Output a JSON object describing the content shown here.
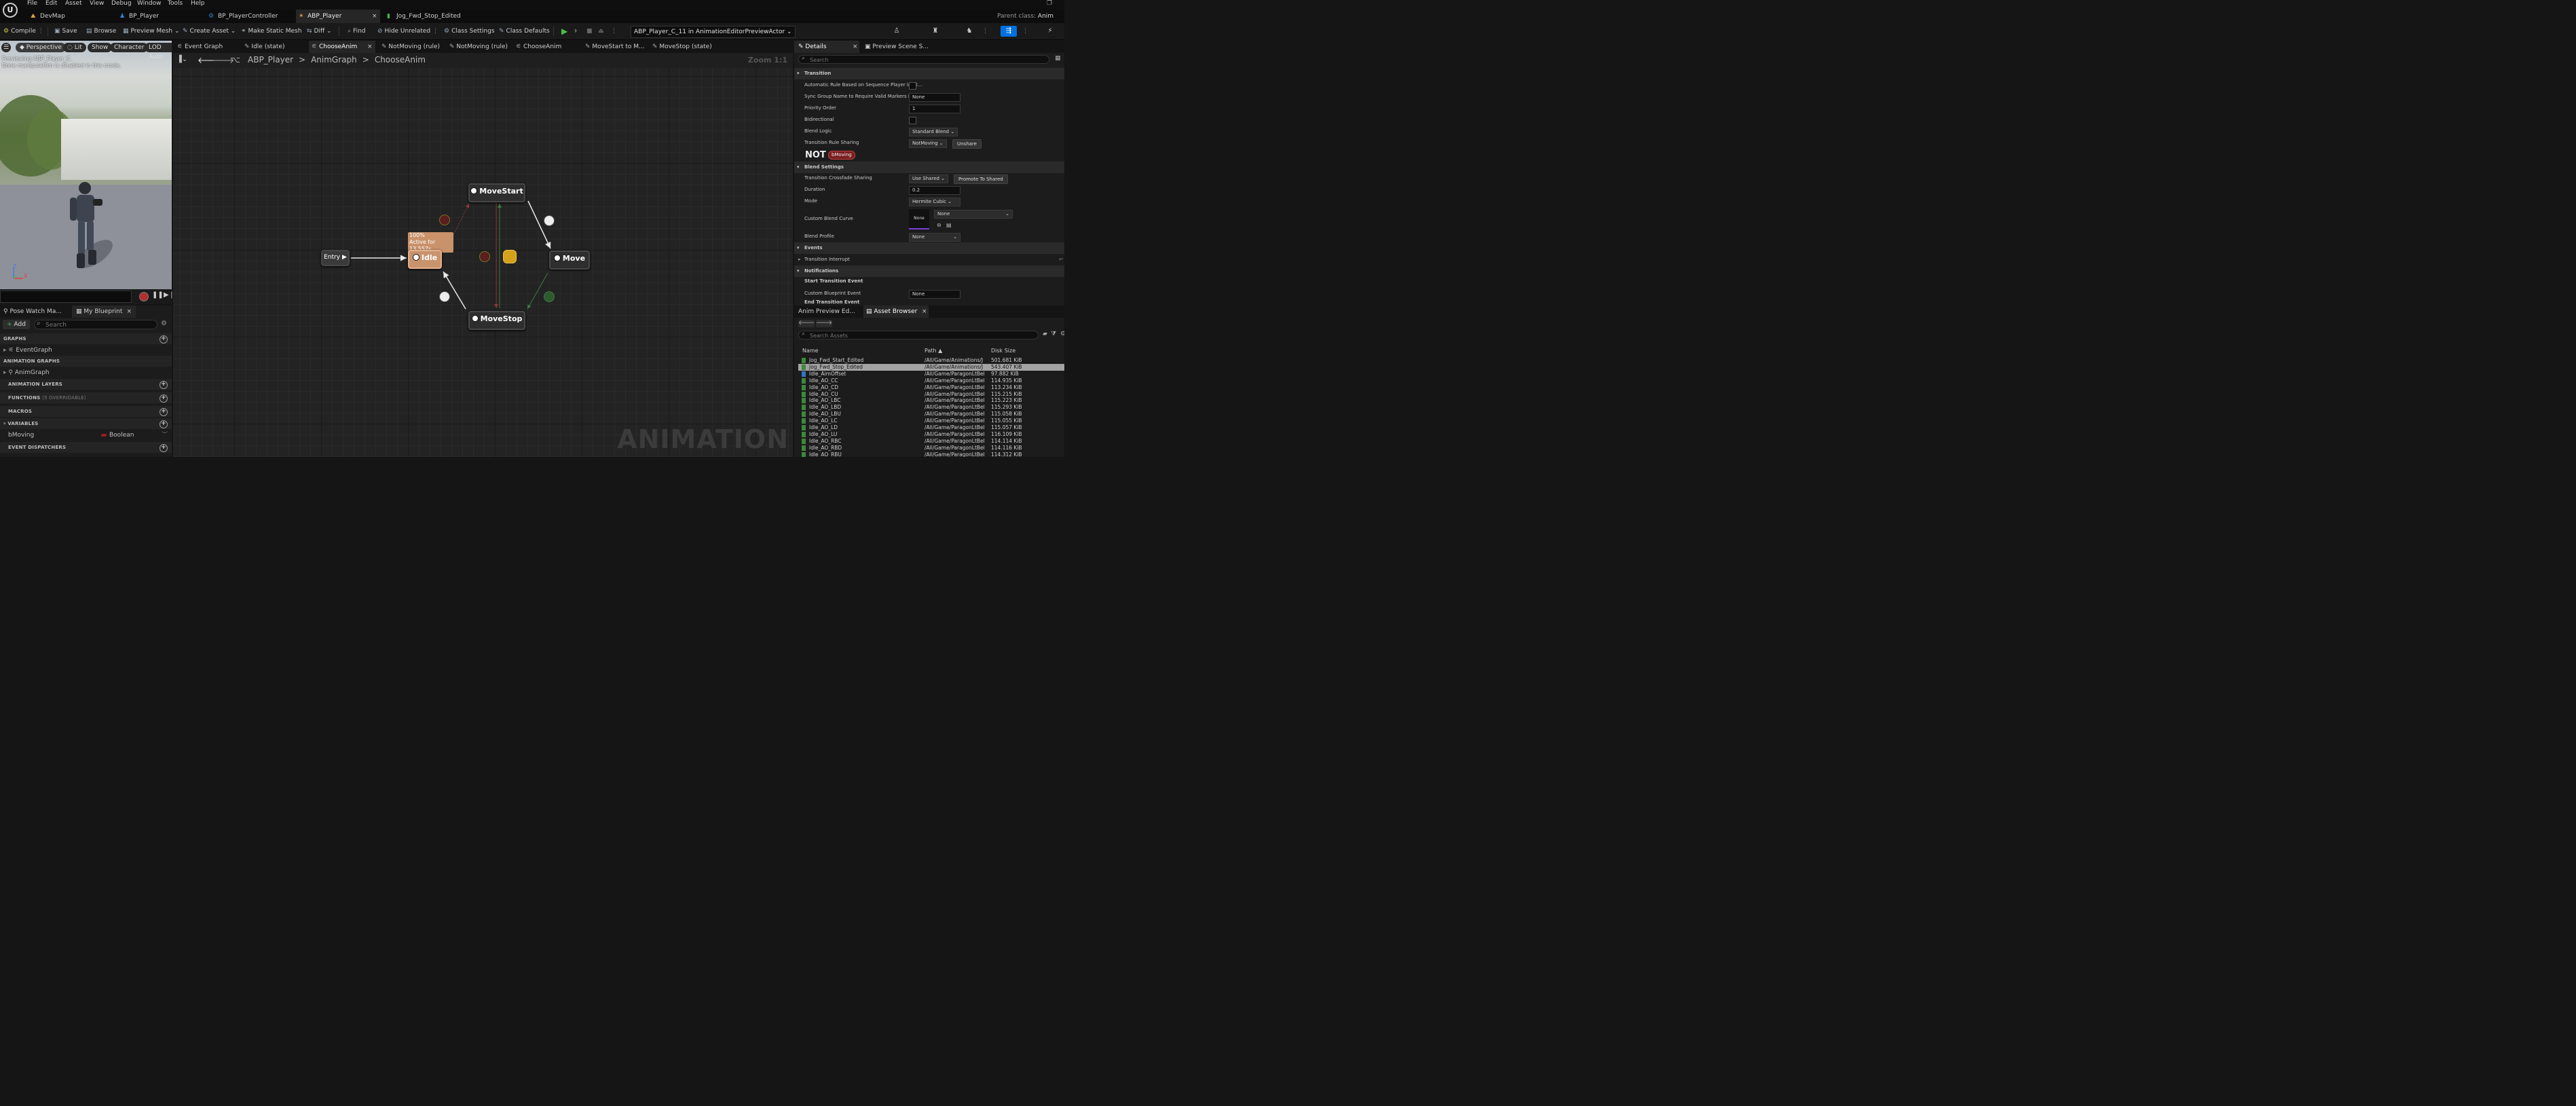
{
  "menu": [
    "File",
    "Edit",
    "Asset",
    "View",
    "Debug",
    "Window",
    "Tools",
    "Help"
  ],
  "tabs": [
    {
      "label": "DevMap"
    },
    {
      "label": "BP_Player"
    },
    {
      "label": "BP_PlayerController"
    },
    {
      "label": "ABP_Player",
      "close": "×"
    },
    {
      "label": "Jog_Fwd_Stop_Edited"
    }
  ],
  "parent_class": {
    "label": "Parent class:",
    "value": "Anim Instanc"
  },
  "toolbar": {
    "compile": "Compile",
    "save": "Save",
    "browse": "Browse",
    "preview_mesh": "Preview Mesh",
    "create_asset": "Create Asset",
    "make_static_mesh": "Make Static Mesh",
    "diff": "Diff",
    "find": "Find",
    "hide_unrelated": "Hide Unrelated",
    "class_settings": "Class Settings",
    "class_defaults": "Class Defaults",
    "debug_target": "ABP_Player_C_11 in AnimationEditorPreviewActor"
  },
  "viewport": {
    "perspective": "Perspective",
    "lit": "Lit",
    "show": "Show",
    "character": "Character",
    "lod": "LOD Auto",
    "msg1": "Previewing ABP_Player_C.",
    "msg2": "Bone manipulation is disabled in this mode.",
    "axis_z": "Z",
    "axis_x": "X"
  },
  "left_panel": {
    "tab1": "Pose Watch Ma...",
    "tab2": "My Blueprint",
    "add": "Add",
    "search_placeholder": "Search",
    "graphs": "GRAPHS",
    "event_graph": "EventGraph",
    "animation_graphs": "ANIMATION GRAPHS",
    "anim_graph": "AnimGraph",
    "animation_layers": "ANIMATION LAYERS",
    "functions": "FUNCTIONS",
    "functions_note": "(5 OVERRIDABLE)",
    "macros": "MACROS",
    "variables": "VARIABLES",
    "var_name": "bMoving",
    "var_type": "Boolean",
    "event_dispatchers": "EVENT DISPATCHERS"
  },
  "graph_tabs": [
    {
      "label": "Event Graph"
    },
    {
      "label": "Idle (state)"
    },
    {
      "label": "ChooseAnim",
      "close": "×"
    },
    {
      "label": "NotMoving (rule)"
    },
    {
      "label": "NotMoving (rule)"
    },
    {
      "label": "ChooseAnim"
    },
    {
      "label": "MoveStart to M..."
    },
    {
      "label": "MoveStop (state)"
    }
  ],
  "breadcrumb": {
    "root": "ABP_Player",
    "mid": "AnimGraph",
    "leaf": "ChooseAnim",
    "sep": ">",
    "zoom": "Zoom 1:1"
  },
  "graph": {
    "entry": "Entry",
    "idle": "Idle",
    "move_start": "MoveStart",
    "move": "Move",
    "move_stop": "MoveStop",
    "badge_pct": "100%",
    "badge_active": "Active for 13.557s",
    "watermark": "ANIMATION"
  },
  "details_tabs": {
    "details": "Details",
    "preview": "Preview Scene S..."
  },
  "details": {
    "search_placeholder": "Search",
    "transition": "Transition",
    "auto_rule": "Automatic Rule Based on Sequence Player in St...",
    "sync_group": "Sync Group Name to Require Valid Markers Rule",
    "sync_group_val": "None",
    "priority": "Priority Order",
    "priority_val": "1",
    "bidirectional": "Bidirectional",
    "blend_logic": "Blend Logic",
    "blend_logic_val": "Standard Blend",
    "rule_sharing": "Transition Rule Sharing",
    "rule_sharing_val": "NotMoving",
    "unshare": "Unshare",
    "not_label": "NOT",
    "not_var": "bMoving",
    "blend_settings": "Blend Settings",
    "crossfade": "Transition Crossfade Sharing",
    "crossfade_val": "Use Shared",
    "promote": "Promote To Shared",
    "duration": "Duration",
    "duration_val": "0.2",
    "mode": "Mode",
    "mode_val": "Hermite Cubic",
    "custom_curve": "Custom Blend Curve",
    "curve_none": "None",
    "curve_dd": "None",
    "blend_profile": "Blend Profile",
    "blend_profile_val": "None",
    "events": "Events",
    "transition_interrupt": "Transition Interrupt",
    "notifications": "Notifications",
    "start_event": "Start Transition Event",
    "custom_bp_event": "Custom Blueprint Event",
    "custom_bp_event_val": "None",
    "end_event": "End Transition Event"
  },
  "asset_tabs": {
    "preview": "Anim Preview Ed...",
    "browser": "Asset Browser"
  },
  "asset_browser": {
    "search_placeholder": "Search Assets",
    "col_name": "Name",
    "col_path": "Path",
    "col_size": "Disk Size",
    "rows": [
      {
        "name": "Jog_Fwd_Start_Edited",
        "path": "/All/Game/Animations/J",
        "size": "501.681 KiB"
      },
      {
        "name": "Jog_Fwd_Stop_Edited",
        "path": "/All/Game/Animations/J",
        "size": "543.407 KiB",
        "selected": true
      },
      {
        "name": "Idle_AimOffset",
        "path": "/All/Game/ParagonLtBel",
        "size": "97.882 KiB",
        "blue": true
      },
      {
        "name": "Idle_AO_CC",
        "path": "/All/Game/ParagonLtBel",
        "size": "114.935 KiB"
      },
      {
        "name": "Idle_AO_CD",
        "path": "/All/Game/ParagonLtBel",
        "size": "113.234 KiB"
      },
      {
        "name": "Idle_AO_CU",
        "path": "/All/Game/ParagonLtBel",
        "size": "115.215 KiB"
      },
      {
        "name": "Idle_AO_LBC",
        "path": "/All/Game/ParagonLtBel",
        "size": "115.223 KiB"
      },
      {
        "name": "Idle_AO_LBD",
        "path": "/All/Game/ParagonLtBel",
        "size": "115.293 KiB"
      },
      {
        "name": "Idle_AO_LBU",
        "path": "/All/Game/ParagonLtBel",
        "size": "115.058 KiB"
      },
      {
        "name": "Idle_AO_LC",
        "path": "/All/Game/ParagonLtBel",
        "size": "115.055 KiB"
      },
      {
        "name": "Idle_AO_LD",
        "path": "/All/Game/ParagonLtBel",
        "size": "115.057 KiB"
      },
      {
        "name": "Idle_AO_LU",
        "path": "/All/Game/ParagonLtBel",
        "size": "116.109 KiB"
      },
      {
        "name": "Idle_AO_RBC",
        "path": "/All/Game/ParagonLtBel",
        "size": "114.114 KiB"
      },
      {
        "name": "Idle_AO_RBD",
        "path": "/All/Game/ParagonLtBel",
        "size": "114.116 KiB"
      },
      {
        "name": "Idle_AO_RBU",
        "path": "/All/Game/ParagonLtBel",
        "size": "114.312 KiB"
      }
    ]
  },
  "colors": {
    "accent_blue": "#0070e0",
    "active_node": "#c9946d",
    "play_green": "#4bc043"
  }
}
